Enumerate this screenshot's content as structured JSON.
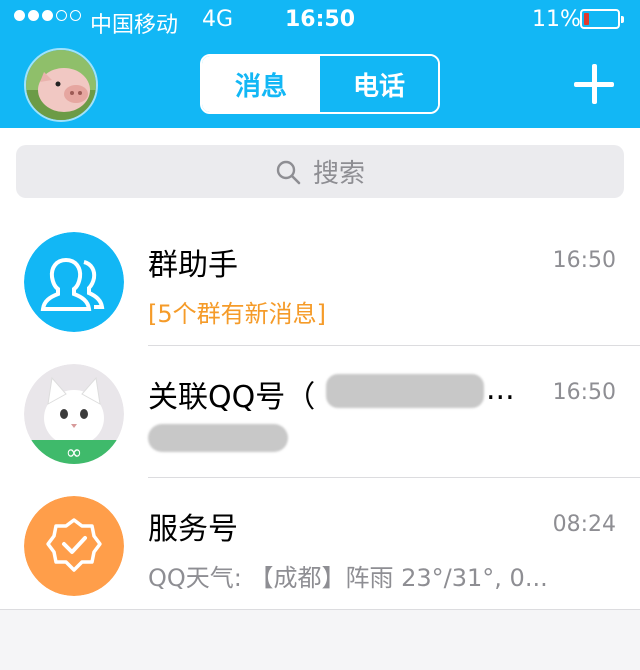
{
  "status_bar": {
    "carrier": "中国移动",
    "network": "4G",
    "time": "16:50",
    "battery": "11%",
    "signal_bars_filled": 3,
    "signal_bars_total": 5
  },
  "header": {
    "tabs": [
      {
        "label": "消息",
        "active": true
      },
      {
        "label": "电话",
        "active": false
      }
    ],
    "accent_color": "#12b7f5"
  },
  "search": {
    "placeholder": "搜索"
  },
  "conversations": [
    {
      "name": "群助手",
      "time": "16:50",
      "preview": "[5个群有新消息]",
      "preview_color": "#f59b29",
      "icon": "group-assistant-icon"
    },
    {
      "name": "关联QQ号（",
      "name_suffix": "...",
      "time": "16:50",
      "preview": "",
      "icon": "linked-account-avatar"
    },
    {
      "name": "服务号",
      "time": "08:24",
      "preview": "QQ天气: 【成都】阵雨 23°/31°, 0...",
      "icon": "service-badge-icon"
    }
  ]
}
